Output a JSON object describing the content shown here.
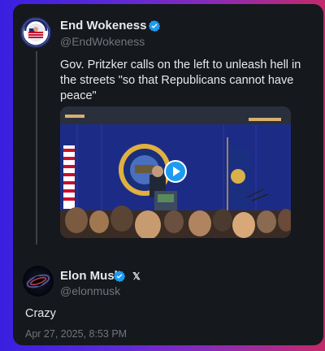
{
  "original_post": {
    "author_name": "End Wokeness",
    "author_handle": "@EndWokeness",
    "avatar_text": "END WOKENESS",
    "text": "Gov. Pritzker calls on the left to unleash hell in the streets \"so that Republicans cannot have peace\""
  },
  "reply_post": {
    "author_name": "Elon Musk",
    "author_handle": "@elonmusk",
    "badge_glyph": "𝕏",
    "text": "Crazy",
    "timestamp": "Apr 27, 2025, 8:53 PM"
  },
  "icons": {
    "verified": "verified-badge-icon",
    "play": "play-icon",
    "x_affiliate": "x-logo-icon"
  },
  "colors": {
    "verified_blue": "#1d9bf0",
    "card_bg": "#15181d",
    "text_primary": "#e7e9ea",
    "text_secondary": "#71767b"
  }
}
